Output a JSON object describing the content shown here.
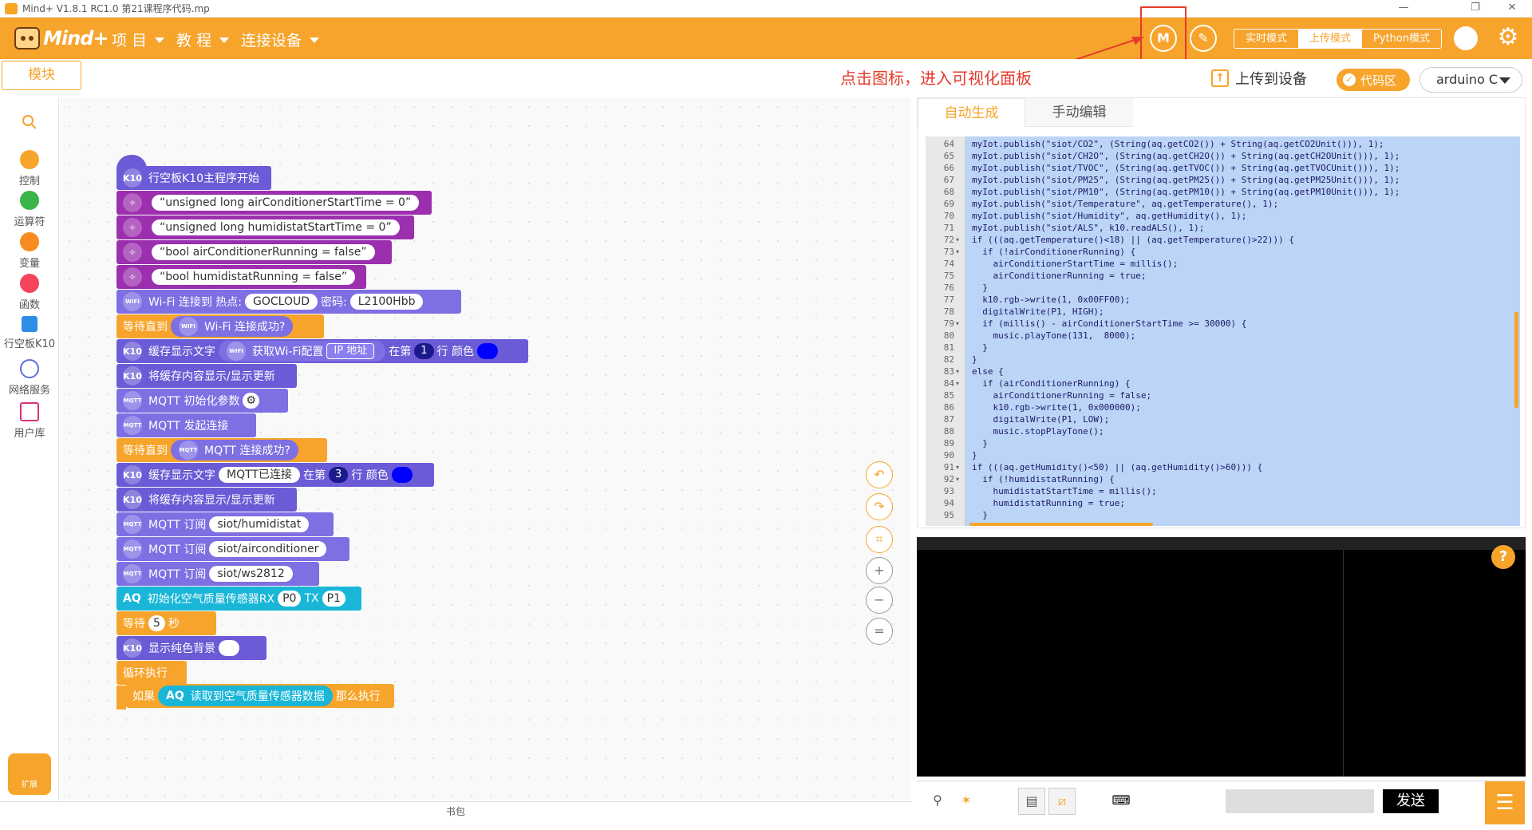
{
  "window": {
    "title": "Mind+ V1.8.1 RC1.0    第21课程序代码.mp"
  },
  "menubar": {
    "brand": "Mind+",
    "items": [
      {
        "label": "项 目"
      },
      {
        "label": "教 程"
      },
      {
        "label": "连接设备"
      }
    ],
    "modes": [
      {
        "label": "实时模式"
      },
      {
        "label": "上传模式"
      },
      {
        "label": "Python模式"
      }
    ],
    "active_mode": "上传模式",
    "icons": [
      "visual-panel-icon",
      "edit-icon",
      "robot-icon",
      "gear-icon"
    ]
  },
  "subbar": {
    "modules_tab": "模块",
    "annotation": "点击图标，进入可视化面板",
    "upload": "上传到设备",
    "code_toggle": "代码区",
    "language": "arduino C"
  },
  "palette": {
    "categories": [
      {
        "label": "控制",
        "color": "#f7a42c"
      },
      {
        "label": "运算符",
        "color": "#3bb54a"
      },
      {
        "label": "变量",
        "color": "#f78b1f"
      },
      {
        "label": "函数",
        "color": "#f5455c"
      },
      {
        "label": "行空板K10",
        "color": "#2f8ee5"
      },
      {
        "label": "网络服务",
        "color": "#5b6ee1"
      },
      {
        "label": "用户库",
        "color": "#d6347a"
      }
    ],
    "extension_label": "扩展"
  },
  "blocks": {
    "b1": "行空板K10主程序开始",
    "b2": "unsigned long airConditionerStartTime = 0",
    "b3": "unsigned long humidistatStartTime = 0",
    "b4": "bool airConditionerRunning = false",
    "b5": "bool humidistatRunning = false",
    "b6_a": "Wi-Fi 连接到 热点:",
    "b6_ssid": "GOCLOUD",
    "b6_b": "密码:",
    "b6_pwd": "L2100Hbb",
    "b7_a": "等待直到",
    "b7_b": "Wi-Fi 连接成功?",
    "b8_a": "缓存显示文字",
    "b8_b": "获取Wi-Fi配置",
    "b8_opt": "IP 地址",
    "b8_c": "在第",
    "b8_row": "1",
    "b8_d": "行 颜色",
    "b9": "将缓存内容显示/显示更新",
    "b10": "MQTT 初始化参数",
    "b11": "MQTT 发起连接",
    "b12_a": "等待直到",
    "b12_b": "MQTT 连接成功?",
    "b13_a": "缓存显示文字",
    "b13_text": "MQTT已连接",
    "b13_b": "在第",
    "b13_row": "3",
    "b13_c": "行 颜色",
    "b14": "将缓存内容显示/显示更新",
    "b15_a": "MQTT 订阅",
    "b15_t": "siot/humidistat",
    "b16_a": "MQTT 订阅",
    "b16_t": "siot/airconditioner",
    "b17_a": "MQTT 订阅",
    "b17_t": "siot/ws2812",
    "b18_a": "初始化空气质量传感器RX",
    "b18_rx": "P0",
    "b18_b": "TX",
    "b18_tx": "P1",
    "b19_a": "等待",
    "b19_n": "5",
    "b19_b": "秒",
    "b20": "显示纯色背景",
    "b21": "循环执行",
    "b22_a": "如果",
    "b22_b": "读取到空气质量传感器数据",
    "b22_c": "那么执行",
    "aq_badge": "AQ",
    "wifi_badge": "WIFI",
    "mqtt_badge": "MQTT",
    "k10_badge": "K10"
  },
  "workspace": {
    "bookbar": "书包"
  },
  "code": {
    "tabs": [
      {
        "label": "自动生成"
      },
      {
        "label": "手动编辑"
      }
    ],
    "lines": [
      {
        "n": "64",
        "t": "myIot.publish(\"siot/CO2\", (String(aq.getCO2()) + String(aq.getCO2Unit())), 1);"
      },
      {
        "n": "65",
        "t": "myIot.publish(\"siot/CH2O\", (String(aq.getCH2O()) + String(aq.getCH2OUnit())), 1);"
      },
      {
        "n": "66",
        "t": "myIot.publish(\"siot/TVOC\", (String(aq.getTVOC()) + String(aq.getTVOCUnit())), 1);"
      },
      {
        "n": "67",
        "t": "myIot.publish(\"siot/PM25\", (String(aq.getPM25()) + String(aq.getPM25Unit())), 1);"
      },
      {
        "n": "68",
        "t": "myIot.publish(\"siot/PM10\", (String(aq.getPM10()) + String(aq.getPM10Unit())), 1);"
      },
      {
        "n": "69",
        "t": "myIot.publish(\"siot/Temperature\", aq.getTemperature(), 1);"
      },
      {
        "n": "70",
        "t": "myIot.publish(\"siot/Humidity\", aq.getHumidity(), 1);"
      },
      {
        "n": "71",
        "t": "myIot.publish(\"siot/ALS\", k10.readALS(), 1);"
      },
      {
        "n": "72",
        "t": "if (((aq.getTemperature()<18) || (aq.getTemperature()>22))) {",
        "f": true
      },
      {
        "n": "73",
        "t": "  if (!airConditionerRunning) {",
        "f": true
      },
      {
        "n": "74",
        "t": "    airConditionerStartTime = millis();"
      },
      {
        "n": "75",
        "t": "    airConditionerRunning = true;"
      },
      {
        "n": "76",
        "t": "  }"
      },
      {
        "n": "77",
        "t": "  k10.rgb->write(1, 0x00FF00);"
      },
      {
        "n": "78",
        "t": "  digitalWrite(P1, HIGH);"
      },
      {
        "n": "79",
        "t": "  if (millis() - airConditionerStartTime >= 30000) {",
        "f": true
      },
      {
        "n": "80",
        "t": "    music.playTone(131,  8000);"
      },
      {
        "n": "81",
        "t": "  }"
      },
      {
        "n": "82",
        "t": "}"
      },
      {
        "n": "83",
        "t": "else {",
        "f": true
      },
      {
        "n": "84",
        "t": "  if (airConditionerRunning) {",
        "f": true
      },
      {
        "n": "85",
        "t": "    airConditionerRunning = false;"
      },
      {
        "n": "86",
        "t": "    k10.rgb->write(1, 0x000000);"
      },
      {
        "n": "87",
        "t": "    digitalWrite(P1, LOW);"
      },
      {
        "n": "88",
        "t": "    music.stopPlayTone();"
      },
      {
        "n": "89",
        "t": "  }"
      },
      {
        "n": "90",
        "t": "}"
      },
      {
        "n": "91",
        "t": "if (((aq.getHumidity()<50) || (aq.getHumidity()>60))) {",
        "f": true
      },
      {
        "n": "92",
        "t": "  if (!humidistatRunning) {",
        "f": true
      },
      {
        "n": "93",
        "t": "    humidistatStartTime = millis();"
      },
      {
        "n": "94",
        "t": "    humidistatRunning = true;"
      },
      {
        "n": "95",
        "t": "  }"
      }
    ]
  },
  "terminal": {
    "send": "发送",
    "help": "?"
  }
}
